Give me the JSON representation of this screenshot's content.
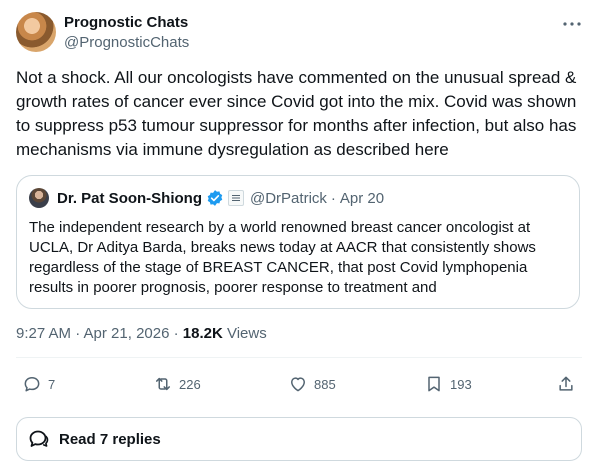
{
  "author": {
    "name": "Prognostic Chats",
    "handle": "@PrognosticChats"
  },
  "tweet": {
    "text": "Not a shock. All our oncologists have commented on the unusual spread & growth rates of cancer ever since Covid got into the mix. Covid was shown to suppress p53 tumour suppressor for months after infection, but also has mechanisms via immune dysregulation as described here"
  },
  "quote": {
    "name": "Dr. Pat Soon-Shiong",
    "handle": "@DrPatrick",
    "separator": "·",
    "date": "Apr 20",
    "text": "The independent research by a world renowned breast cancer oncologist at UCLA, Dr Aditya Barda, breaks news today at AACR that consistently shows regardless of the stage of BREAST CANCER, that post Covid lymphopenia results in poorer prognosis, poorer response to treatment and"
  },
  "meta": {
    "time": "9:27 AM · Apr 21, 2026 · ",
    "views_count": "18.2K",
    "views_label": " Views"
  },
  "actions": {
    "replies": "7",
    "reposts": "226",
    "likes": "885",
    "bookmarks": "193"
  },
  "read_replies": "Read 7 replies",
  "icons": {
    "more": "more-icon",
    "verified": "verified-badge-icon",
    "reply": "reply-icon",
    "repost": "repost-icon",
    "like": "heart-icon",
    "bookmark": "bookmark-icon",
    "share": "share-icon",
    "replies": "speech-bubbles-icon"
  },
  "colors": {
    "verified": "#1d9bf0",
    "muted": "#536471",
    "text": "#0f1419",
    "border": "#cfd9de"
  }
}
